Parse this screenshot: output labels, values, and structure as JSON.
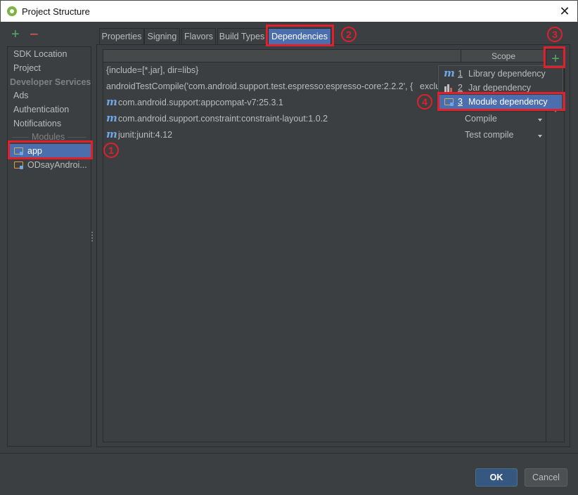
{
  "window": {
    "title": "Project Structure",
    "close_glyph": "✕"
  },
  "left_panel": {
    "add_glyph": "+",
    "remove_glyph": "−",
    "items": {
      "sdk_location": "SDK Location",
      "project": "Project",
      "developer_services": "Developer Services",
      "ads": "Ads",
      "authentication": "Authentication",
      "notifications": "Notifications",
      "modules": "Modules"
    },
    "modules": [
      {
        "label": "app",
        "selected": true
      },
      {
        "label": "ODsayAndroi..."
      }
    ]
  },
  "tabs": [
    {
      "label": "Properties"
    },
    {
      "label": "Signing"
    },
    {
      "label": "Flavors"
    },
    {
      "label": "Build Types"
    },
    {
      "label": "Dependencies",
      "active": true
    }
  ],
  "table": {
    "scope_header": "Scope",
    "add_glyph": "+",
    "rows": [
      {
        "name": "{include=[*.jar], dir=libs}",
        "scope": "",
        "icon": "none"
      },
      {
        "name": "androidTestCompile('com.android.support.test.espresso:espresso-core:2.2.2', {",
        "scope": "exclu",
        "icon": "none"
      },
      {
        "name": "com.android.support:appcompat-v7:25.3.1",
        "scope": "",
        "icon": "maven-icon"
      },
      {
        "name": "com.android.support.constraint:constraint-layout:1.0.2",
        "scope": "Compile",
        "icon": "maven-icon"
      },
      {
        "name": "junit:junit:4.12",
        "scope": "Test compile",
        "icon": "maven-icon"
      }
    ],
    "maven_glyph": "m"
  },
  "add_menu": {
    "items": [
      {
        "num": "1",
        "label": "Library dependency",
        "icon": "maven-icon"
      },
      {
        "num": "2",
        "label": "Jar dependency",
        "icon": "jar-icon"
      },
      {
        "num": "3",
        "label": "Module dependency",
        "icon": "module-icon",
        "selected": true
      }
    ]
  },
  "annotations": {
    "b1": "1",
    "b2": "2",
    "b3": "3",
    "b4": "4"
  },
  "buttons": {
    "ok": "OK",
    "cancel": "Cancel"
  },
  "colors": {
    "selection": "#4b6eaf",
    "annotation": "#e0202a",
    "add": "#59a869",
    "remove": "#e05555"
  }
}
